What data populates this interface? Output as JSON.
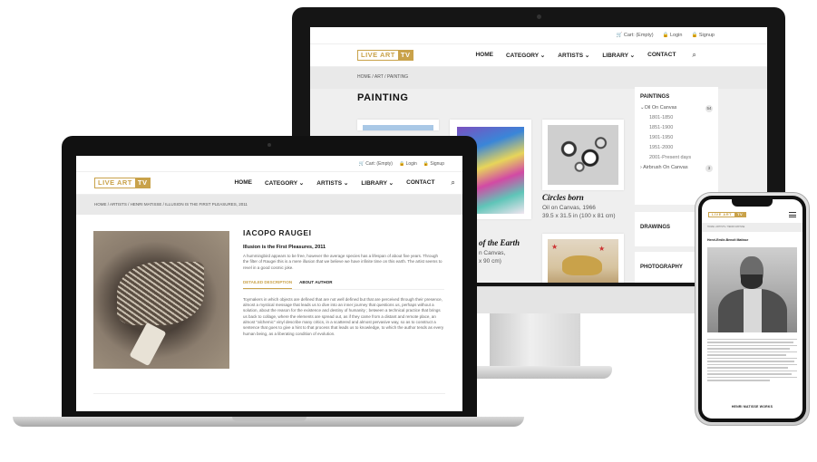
{
  "brand": {
    "logo_left": "LIVE ART",
    "logo_right": "TV",
    "accent": "#c9a24a"
  },
  "monitor": {
    "topbar": {
      "cart": "Cart: (Empty)",
      "login": "Login",
      "signup": "Signup"
    },
    "nav": [
      "HOME",
      "CATEGORY",
      "ARTISTS",
      "LIBRARY",
      "CONTACT"
    ],
    "breadcrumb": "HOME / ART / PAINTING",
    "page_title": "PAINTING",
    "cards": [
      {
        "title": "Circles born",
        "meta1": "Oil on Canvas, 1966",
        "meta2": "39.5 x 31.5 in (100 x 81 cm)"
      },
      {
        "title_partial": "of the Earth",
        "meta1_partial": "n Canvas,",
        "meta2_partial": "x 90 cm)"
      }
    ],
    "sidebar": {
      "painting": {
        "heading": "PAINTINGS",
        "items": [
          {
            "label": "Oil On Canvas",
            "count": "54"
          },
          {
            "label": "1801-1850"
          },
          {
            "label": "1851-1900"
          },
          {
            "label": "1901-1950"
          },
          {
            "label": "1951-2000"
          },
          {
            "label": "2001-Present days"
          },
          {
            "label": "Airbrush On Canvas",
            "count": "3"
          }
        ]
      },
      "drawings": "DRAWINGS",
      "photography": "PHOTOGRAPHY"
    }
  },
  "laptop": {
    "topbar": {
      "cart": "Cart: (Empty)",
      "login": "Login",
      "signup": "Signup"
    },
    "nav": [
      "HOME",
      "CATEGORY",
      "ARTISTS",
      "LIBRARY",
      "CONTACT"
    ],
    "breadcrumb": "HOME / ARTISTS / HENRI MATISSE / ILLUSION IS THE FIRST PLEASURES, 2011",
    "artist": "IACOPO RAUGEI",
    "artwork_title": "Illusion is the First Pleasures, 2011",
    "intro": "A hummingbird appears to be free, however the average species has a lifespan of about five years. Through the filter of Raugei this is a mere illusion that we believe we have infinite time on this earth. The artist seems to revel in a good cosmic joke.",
    "tabs": {
      "detailed": "DETAILED DESCRIPTION",
      "about": "ABOUT AUTHOR"
    },
    "description": "Toymakers in which objects are defined that are not well defined but that are perceived through their presence, almost a mystical message that leads us to dive into an inner journey that questions us, perhaps without a solution, about the reason for the existence and destiny of humanity ; between a technical practice that brings us back to collage, where the elements are spread out, as if they came from a distant and remote place, an almost \"alchemic\" vinyl describe many critics, in a scattered and almost pervasive way, so as to construct a sentence that goes to give a hint to that process that leads us to knowledge, to which the author tends as every human being, as a liberating condition of evolution."
  },
  "phone": {
    "breadcrumb": "HOME / ARTISTS / HENRI MATISSE",
    "title": "Henri-Emile-Benoît Matisse",
    "button": "HENRI MATISSE WORKS"
  }
}
